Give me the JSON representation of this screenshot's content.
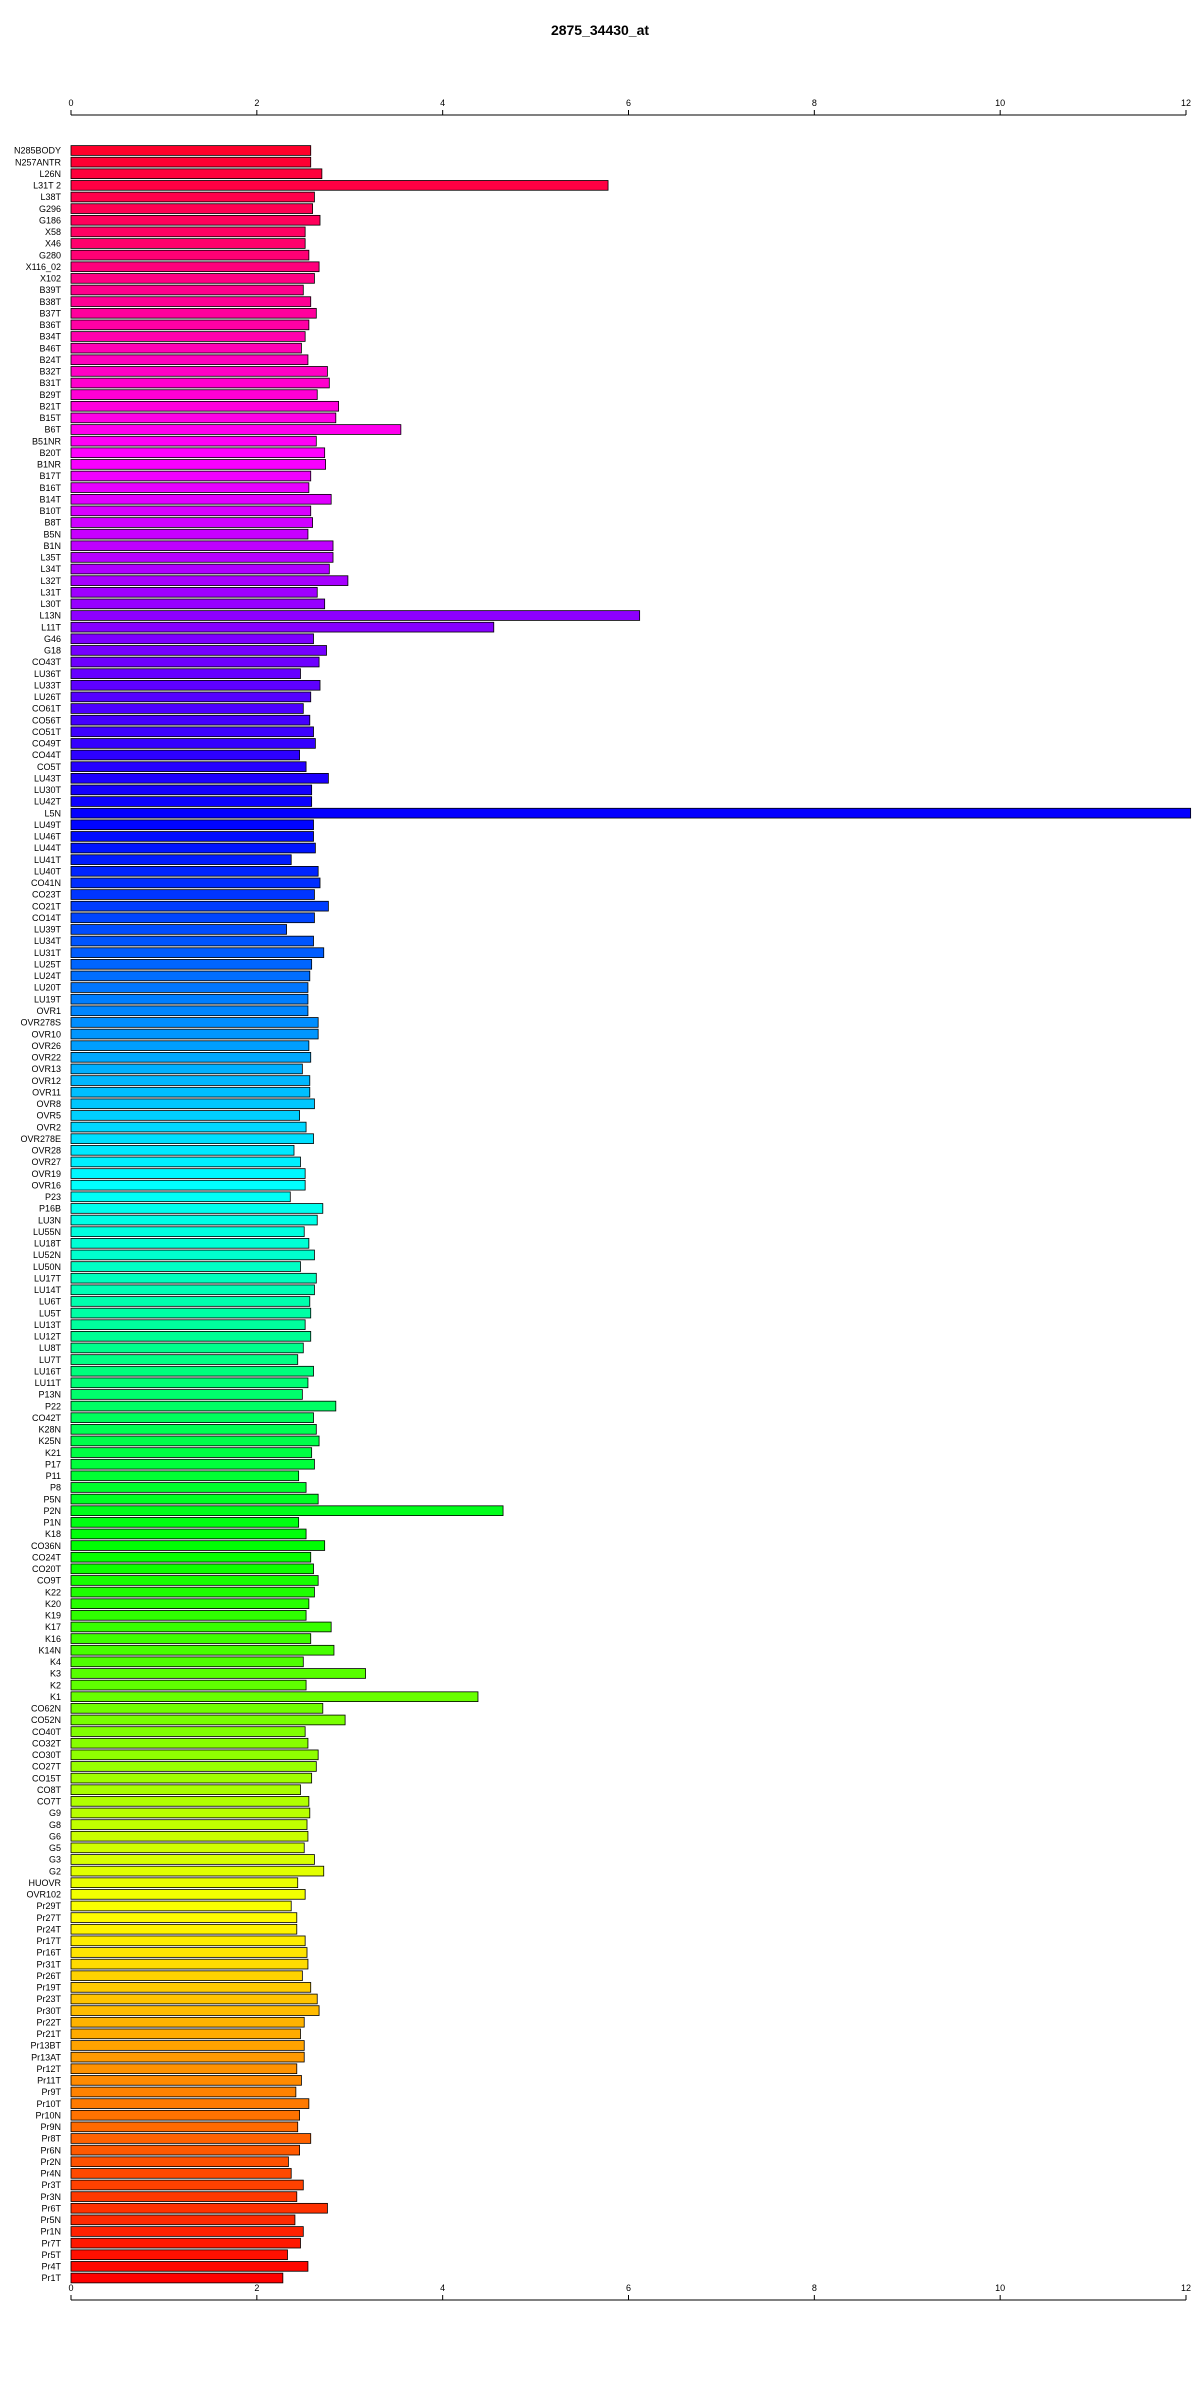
{
  "chart_data": {
    "type": "bar",
    "orientation": "horizontal",
    "title": "2875_34430_at",
    "xlabel": "",
    "ylabel": "",
    "xlim": [
      0,
      12
    ],
    "ticks": [
      "0",
      "2",
      "4",
      "6",
      "8",
      "10",
      "12"
    ],
    "grid": false,
    "legend": "none",
    "palette": "rainbow red-magenta-blue-cyan-green-yellow-orange-red",
    "categories": [
      "N285BODY",
      "N257ANTR",
      "L26N",
      "L31T 2",
      "L38T",
      "G296",
      "G186",
      "X58",
      "X46",
      "G280",
      "X116_02",
      "X102",
      "B39T",
      "B38T",
      "B37T",
      "B36T",
      "B34T",
      "B46T",
      "B24T",
      "B32T",
      "B31T",
      "B29T",
      "B21T",
      "B15T",
      "B6T",
      "B51NR",
      "B20T",
      "B1NR",
      "B17T",
      "B16T",
      "B14T",
      "B10T",
      "B8T",
      "B5N",
      "B1N",
      "L35T",
      "L34T",
      "L32T",
      "L31T",
      "L30T",
      "L13N",
      "L11T",
      "G46",
      "G18",
      "CO43T",
      "LU36T",
      "LU33T",
      "LU26T",
      "CO61T",
      "CO56T",
      "CO51T",
      "CO49T",
      "CO44T",
      "CO5T",
      "LU43T",
      "LU30T",
      "LU42T",
      "L5N",
      "LU49T",
      "LU46T",
      "LU44T",
      "LU41T",
      "LU40T",
      "CO41N",
      "CO23T",
      "CO21T",
      "CO14T",
      "LU39T",
      "LU34T",
      "LU31T",
      "LU25T",
      "LU24T",
      "LU20T",
      "LU19T",
      "OVR1",
      "OVR278S",
      "OVR10",
      "OVR26",
      "OVR22",
      "OVR13",
      "OVR12",
      "OVR11",
      "OVR8",
      "OVR5",
      "OVR2",
      "OVR278E",
      "OVR28",
      "OVR27",
      "OVR19",
      "OVR16",
      "P23",
      "P16B",
      "LU3N",
      "LU55N",
      "LU18T",
      "LU52N",
      "LU50N",
      "LU17T",
      "LU14T",
      "LU6T",
      "LU5T",
      "LU13T",
      "LU12T",
      "LU8T",
      "LU7T",
      "LU16T",
      "LU11T",
      "P13N",
      "P22",
      "CO42T",
      "K28N",
      "K25N",
      "K21",
      "P17",
      "P11",
      "P8",
      "P5N",
      "P2N",
      "P1N",
      "K18",
      "CO36N",
      "CO24T",
      "CO20T",
      "CO9T",
      "K22",
      "K20",
      "K19",
      "K17",
      "K16",
      "K14N",
      "K4",
      "K3",
      "K2",
      "K1",
      "CO62N",
      "CO52N",
      "CO40T",
      "CO32T",
      "CO30T",
      "CO27T",
      "CO15T",
      "CO8T",
      "CO7T",
      "G9",
      "G8",
      "G6",
      "G5",
      "G3",
      "G2",
      "HUOVR",
      "OVR102",
      "Pr29T",
      "Pr27T",
      "Pr24T",
      "Pr17T",
      "Pr16T",
      "Pr31T",
      "Pr26T",
      "Pr19T",
      "Pr23T",
      "Pr30T",
      "Pr22T",
      "Pr21T",
      "Pr13BT",
      "Pr13AT",
      "Pr12T",
      "Pr11T",
      "Pr9T",
      "Pr10T",
      "Pr10N",
      "Pr9N",
      "Pr8T",
      "Pr6N",
      "Pr2N",
      "Pr4N",
      "Pr3T",
      "Pr3N",
      "Pr6T",
      "Pr5N",
      "Pr1N",
      "Pr7T",
      "Pr5T",
      "Pr4T",
      "Pr1T"
    ],
    "values": [
      2.58,
      2.58,
      2.7,
      5.78,
      2.62,
      2.6,
      2.68,
      2.52,
      2.52,
      2.56,
      2.67,
      2.62,
      2.5,
      2.58,
      2.64,
      2.56,
      2.52,
      2.48,
      2.55,
      2.76,
      2.78,
      2.65,
      2.88,
      2.85,
      3.55,
      2.64,
      2.73,
      2.74,
      2.58,
      2.56,
      2.8,
      2.58,
      2.6,
      2.55,
      2.82,
      2.82,
      2.78,
      2.98,
      2.65,
      2.73,
      6.12,
      4.55,
      2.61,
      2.75,
      2.67,
      2.47,
      2.68,
      2.58,
      2.5,
      2.57,
      2.61,
      2.63,
      2.46,
      2.53,
      2.77,
      2.59,
      2.59,
      12.05,
      2.61,
      2.61,
      2.63,
      2.37,
      2.66,
      2.68,
      2.62,
      2.77,
      2.62,
      2.32,
      2.61,
      2.72,
      2.59,
      2.57,
      2.55,
      2.55,
      2.55,
      2.66,
      2.66,
      2.56,
      2.58,
      2.49,
      2.57,
      2.57,
      2.62,
      2.46,
      2.53,
      2.61,
      2.4,
      2.47,
      2.52,
      2.52,
      2.36,
      2.71,
      2.65,
      2.51,
      2.56,
      2.62,
      2.47,
      2.64,
      2.62,
      2.57,
      2.58,
      2.52,
      2.58,
      2.5,
      2.44,
      2.61,
      2.55,
      2.49,
      2.85,
      2.61,
      2.64,
      2.67,
      2.59,
      2.62,
      2.45,
      2.53,
      2.66,
      4.65,
      2.45,
      2.53,
      2.73,
      2.58,
      2.61,
      2.66,
      2.62,
      2.56,
      2.53,
      2.8,
      2.58,
      2.83,
      2.5,
      3.17,
      2.53,
      4.38,
      2.71,
      2.95,
      2.52,
      2.55,
      2.66,
      2.64,
      2.59,
      2.47,
      2.56,
      2.57,
      2.54,
      2.55,
      2.51,
      2.62,
      2.72,
      2.44,
      2.52,
      2.37,
      2.43,
      2.43,
      2.52,
      2.54,
      2.55,
      2.49,
      2.58,
      2.65,
      2.67,
      2.51,
      2.47,
      2.51,
      2.51,
      2.43,
      2.48,
      2.42,
      2.56,
      2.46,
      2.44,
      2.58,
      2.46,
      2.34,
      2.37,
      2.5,
      2.43,
      2.76,
      2.41,
      2.5,
      2.47,
      2.33,
      2.55,
      2.28
    ]
  }
}
